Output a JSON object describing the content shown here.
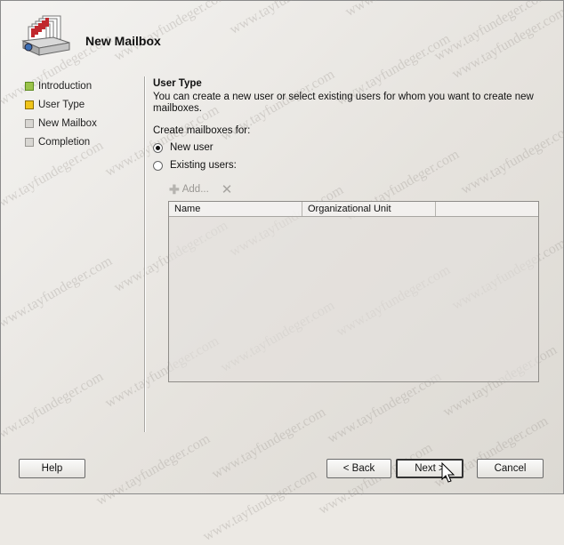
{
  "wizard": {
    "title": "New Mailbox"
  },
  "steps": [
    {
      "label": "Introduction",
      "state": "done"
    },
    {
      "label": "User Type",
      "state": "current"
    },
    {
      "label": "New Mailbox",
      "state": "pending"
    },
    {
      "label": "Completion",
      "state": "pending"
    }
  ],
  "page": {
    "title": "User Type",
    "description": "You can create a new user or select existing users for whom you want to create new mailboxes.",
    "create_for_label": "Create mailboxes for:",
    "options": [
      {
        "label": "New user",
        "selected": true
      },
      {
        "label": "Existing users:",
        "selected": false
      }
    ],
    "toolbar": {
      "add_label": "Add..."
    },
    "grid": {
      "columns": [
        "Name",
        "Organizational Unit"
      ]
    }
  },
  "buttons": {
    "help": "Help",
    "back": "< Back",
    "next": "Next >",
    "cancel": "Cancel"
  },
  "watermark": "www.tayfundeger.com",
  "colors": {
    "done": "#9bc34a",
    "current": "#f0c419",
    "pending": "#d8d6d2"
  },
  "icons": {
    "logo": "mailbox-stack-icon",
    "add": "plus-icon",
    "remove": "x-icon",
    "cursor": "arrow-cursor-icon"
  }
}
